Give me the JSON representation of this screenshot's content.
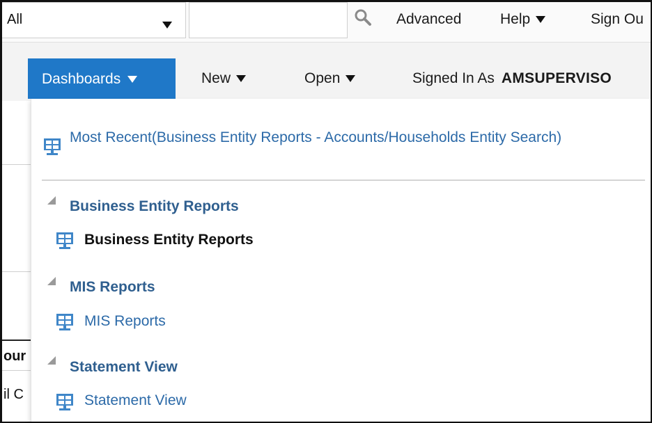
{
  "search": {
    "scope_value": "All",
    "query_placeholder": "",
    "links": {
      "advanced": "Advanced",
      "help": "Help",
      "sign_out": "Sign Ou"
    }
  },
  "menubar": {
    "dashboards": "Dashboards",
    "new": "New",
    "open": "Open",
    "signed_in_label": "Signed In As",
    "signed_in_user": "AMSUPERVISO"
  },
  "background": {
    "fragment_1": "our",
    "fragment_2": "il C"
  },
  "dropdown": {
    "most_recent": "Most Recent(Business Entity Reports - Accounts/Households Entity Search)",
    "sections": [
      {
        "heading": "Business Entity Reports",
        "item": "Business Entity Reports"
      },
      {
        "heading": "MIS Reports",
        "item": "MIS Reports"
      },
      {
        "heading": "Statement View",
        "item": "Statement View"
      }
    ]
  },
  "colors": {
    "primary_button": "#1f78c8",
    "link": "#2c6aa8",
    "section_heading": "#2f5f8f",
    "icon_blue": "#3f86c8"
  }
}
